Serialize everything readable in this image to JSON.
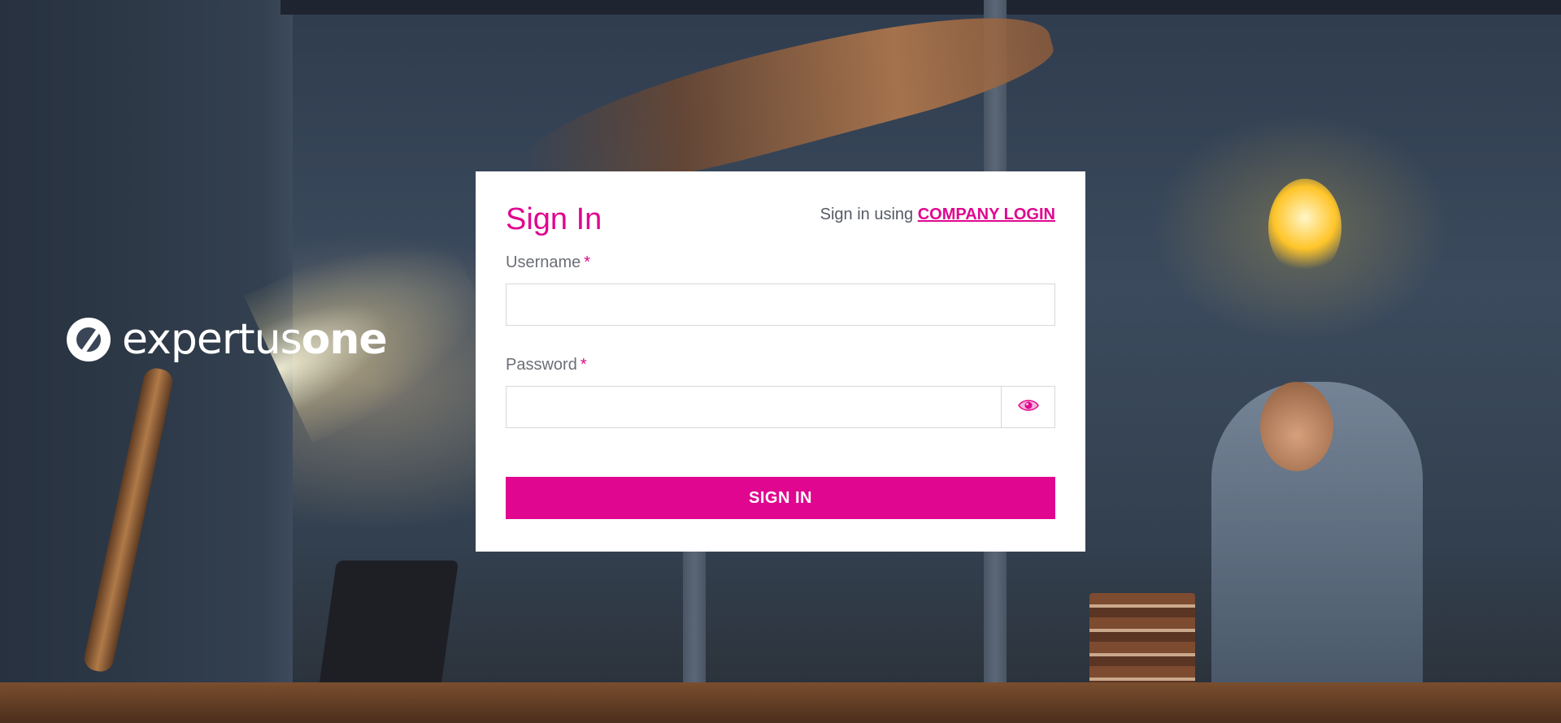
{
  "brand": {
    "logo_text_light": "expertus",
    "logo_text_bold": "one",
    "accent_color": "#e0068f"
  },
  "signin": {
    "title": "Sign In",
    "company_prefix": "Sign in using",
    "company_link": "COMPANY LOGIN",
    "username_label": "Username",
    "password_label": "Password",
    "required_marker": "*",
    "username_value": "",
    "password_value": "",
    "submit_label": "SIGN IN",
    "toggle_icon": "eye-icon"
  }
}
